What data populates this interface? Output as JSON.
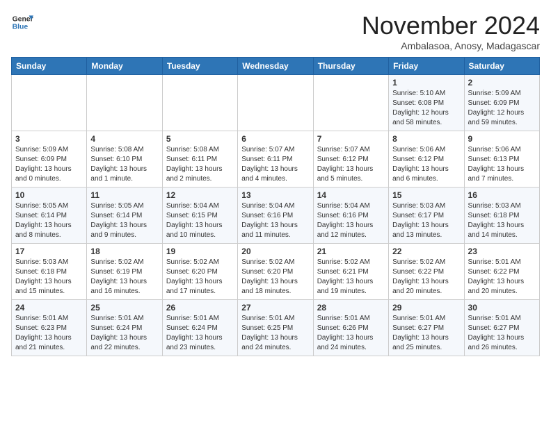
{
  "header": {
    "logo_general": "General",
    "logo_blue": "Blue",
    "month_title": "November 2024",
    "location": "Ambalasoa, Anosy, Madagascar"
  },
  "days_of_week": [
    "Sunday",
    "Monday",
    "Tuesday",
    "Wednesday",
    "Thursday",
    "Friday",
    "Saturday"
  ],
  "weeks": [
    [
      {
        "day": "",
        "content": ""
      },
      {
        "day": "",
        "content": ""
      },
      {
        "day": "",
        "content": ""
      },
      {
        "day": "",
        "content": ""
      },
      {
        "day": "",
        "content": ""
      },
      {
        "day": "1",
        "content": "Sunrise: 5:10 AM\nSunset: 6:08 PM\nDaylight: 12 hours\nand 58 minutes."
      },
      {
        "day": "2",
        "content": "Sunrise: 5:09 AM\nSunset: 6:09 PM\nDaylight: 12 hours\nand 59 minutes."
      }
    ],
    [
      {
        "day": "3",
        "content": "Sunrise: 5:09 AM\nSunset: 6:09 PM\nDaylight: 13 hours\nand 0 minutes."
      },
      {
        "day": "4",
        "content": "Sunrise: 5:08 AM\nSunset: 6:10 PM\nDaylight: 13 hours\nand 1 minute."
      },
      {
        "day": "5",
        "content": "Sunrise: 5:08 AM\nSunset: 6:11 PM\nDaylight: 13 hours\nand 2 minutes."
      },
      {
        "day": "6",
        "content": "Sunrise: 5:07 AM\nSunset: 6:11 PM\nDaylight: 13 hours\nand 4 minutes."
      },
      {
        "day": "7",
        "content": "Sunrise: 5:07 AM\nSunset: 6:12 PM\nDaylight: 13 hours\nand 5 minutes."
      },
      {
        "day": "8",
        "content": "Sunrise: 5:06 AM\nSunset: 6:12 PM\nDaylight: 13 hours\nand 6 minutes."
      },
      {
        "day": "9",
        "content": "Sunrise: 5:06 AM\nSunset: 6:13 PM\nDaylight: 13 hours\nand 7 minutes."
      }
    ],
    [
      {
        "day": "10",
        "content": "Sunrise: 5:05 AM\nSunset: 6:14 PM\nDaylight: 13 hours\nand 8 minutes."
      },
      {
        "day": "11",
        "content": "Sunrise: 5:05 AM\nSunset: 6:14 PM\nDaylight: 13 hours\nand 9 minutes."
      },
      {
        "day": "12",
        "content": "Sunrise: 5:04 AM\nSunset: 6:15 PM\nDaylight: 13 hours\nand 10 minutes."
      },
      {
        "day": "13",
        "content": "Sunrise: 5:04 AM\nSunset: 6:16 PM\nDaylight: 13 hours\nand 11 minutes."
      },
      {
        "day": "14",
        "content": "Sunrise: 5:04 AM\nSunset: 6:16 PM\nDaylight: 13 hours\nand 12 minutes."
      },
      {
        "day": "15",
        "content": "Sunrise: 5:03 AM\nSunset: 6:17 PM\nDaylight: 13 hours\nand 13 minutes."
      },
      {
        "day": "16",
        "content": "Sunrise: 5:03 AM\nSunset: 6:18 PM\nDaylight: 13 hours\nand 14 minutes."
      }
    ],
    [
      {
        "day": "17",
        "content": "Sunrise: 5:03 AM\nSunset: 6:18 PM\nDaylight: 13 hours\nand 15 minutes."
      },
      {
        "day": "18",
        "content": "Sunrise: 5:02 AM\nSunset: 6:19 PM\nDaylight: 13 hours\nand 16 minutes."
      },
      {
        "day": "19",
        "content": "Sunrise: 5:02 AM\nSunset: 6:20 PM\nDaylight: 13 hours\nand 17 minutes."
      },
      {
        "day": "20",
        "content": "Sunrise: 5:02 AM\nSunset: 6:20 PM\nDaylight: 13 hours\nand 18 minutes."
      },
      {
        "day": "21",
        "content": "Sunrise: 5:02 AM\nSunset: 6:21 PM\nDaylight: 13 hours\nand 19 minutes."
      },
      {
        "day": "22",
        "content": "Sunrise: 5:02 AM\nSunset: 6:22 PM\nDaylight: 13 hours\nand 20 minutes."
      },
      {
        "day": "23",
        "content": "Sunrise: 5:01 AM\nSunset: 6:22 PM\nDaylight: 13 hours\nand 20 minutes."
      }
    ],
    [
      {
        "day": "24",
        "content": "Sunrise: 5:01 AM\nSunset: 6:23 PM\nDaylight: 13 hours\nand 21 minutes."
      },
      {
        "day": "25",
        "content": "Sunrise: 5:01 AM\nSunset: 6:24 PM\nDaylight: 13 hours\nand 22 minutes."
      },
      {
        "day": "26",
        "content": "Sunrise: 5:01 AM\nSunset: 6:24 PM\nDaylight: 13 hours\nand 23 minutes."
      },
      {
        "day": "27",
        "content": "Sunrise: 5:01 AM\nSunset: 6:25 PM\nDaylight: 13 hours\nand 24 minutes."
      },
      {
        "day": "28",
        "content": "Sunrise: 5:01 AM\nSunset: 6:26 PM\nDaylight: 13 hours\nand 24 minutes."
      },
      {
        "day": "29",
        "content": "Sunrise: 5:01 AM\nSunset: 6:27 PM\nDaylight: 13 hours\nand 25 minutes."
      },
      {
        "day": "30",
        "content": "Sunrise: 5:01 AM\nSunset: 6:27 PM\nDaylight: 13 hours\nand 26 minutes."
      }
    ]
  ]
}
